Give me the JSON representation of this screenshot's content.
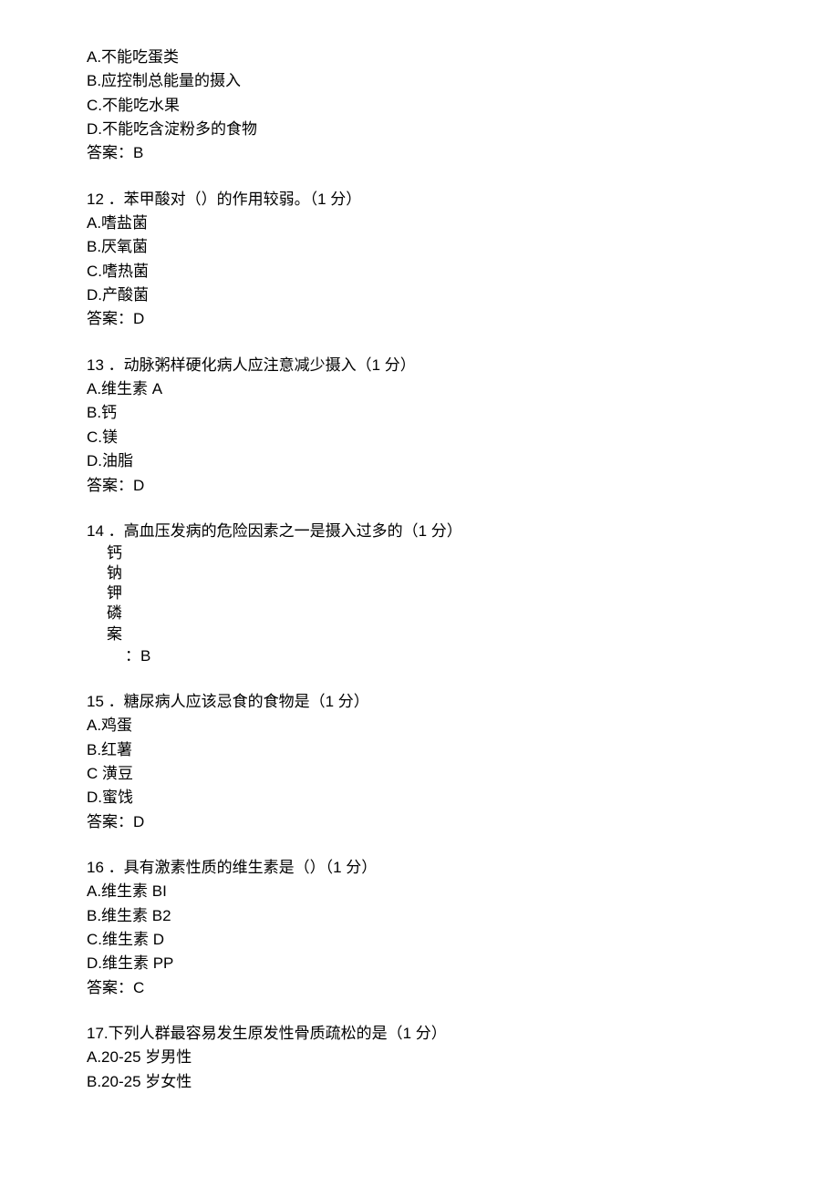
{
  "q11_tail": {
    "options": [
      "A.不能吃蛋类",
      "B.应控制总能量的摄入",
      "C.不能吃水果",
      "D.不能吃含淀粉多的食物"
    ],
    "answer": "答案：B"
  },
  "q12": {
    "question": "12 ．苯甲酸对（）的作用较弱。（1 分）",
    "options": [
      "A.嗜盐菌",
      "B.厌氧菌",
      "C.嗜热菌",
      "D.产酸菌"
    ],
    "answer": "答案：D"
  },
  "q13": {
    "question": "13 ．动脉粥样硬化病人应注意减少摄入（1 分）",
    "options": [
      "A.维生素 A",
      "B.钙",
      "C.镁",
      "D.油脂"
    ],
    "answer": "答案：D"
  },
  "q14": {
    "question": "14 ．高血压发病的危险因素之一是摄入过多的（1 分）",
    "vlines": [
      "钙",
      "钠",
      "钾",
      "磷",
      "案"
    ],
    "vlast": "：B"
  },
  "q15": {
    "question": "15 ．糖尿病人应该忌食的食物是（1 分）",
    "options": [
      "A.鸡蛋",
      "B.红薯",
      "C 潢豆",
      "D.蜜饯"
    ],
    "answer": "答案：D"
  },
  "q16": {
    "question": "16 ．具有激素性质的维生素是（）（1 分）",
    "options": [
      "A.维生素 BI",
      "B.维生素 B2",
      "C.维生素 D",
      "D.维生素 PP"
    ],
    "answer": "答案：C"
  },
  "q17": {
    "question": "17.下列人群最容易发生原发性骨质疏松的是（1 分）",
    "options": [
      "A.20-25 岁男性",
      "B.20-25 岁女性"
    ]
  }
}
